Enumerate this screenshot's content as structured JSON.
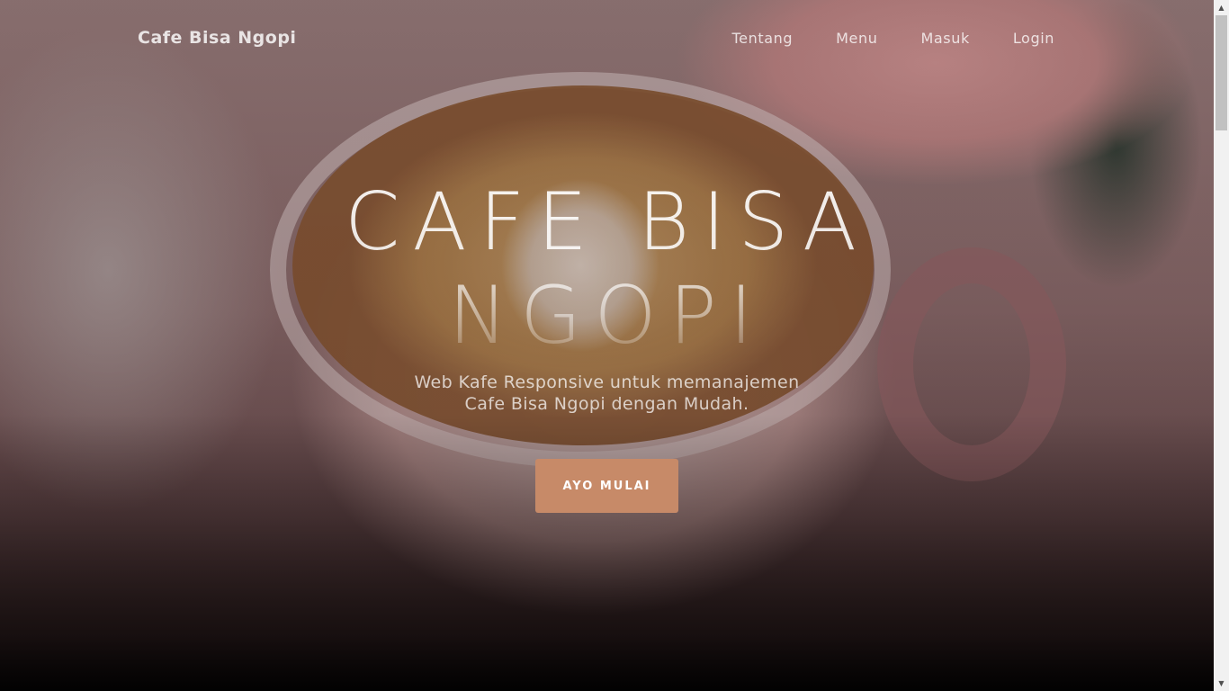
{
  "navbar": {
    "brand": "Cafe Bisa Ngopi",
    "links": [
      "Tentang",
      "Menu",
      "Masuk",
      "Login"
    ]
  },
  "hero": {
    "title_line1": "CAFE BISA",
    "title_line2": "NGOPI",
    "subtitle_line1": "Web Kafe Responsive untuk memanajemen",
    "subtitle_line2": "Cafe Bisa Ngopi dengan Mudah.",
    "cta_label": "AYO MULAI"
  },
  "colors": {
    "cta_background": "#c78a68",
    "text_primary": "#ffffff"
  }
}
